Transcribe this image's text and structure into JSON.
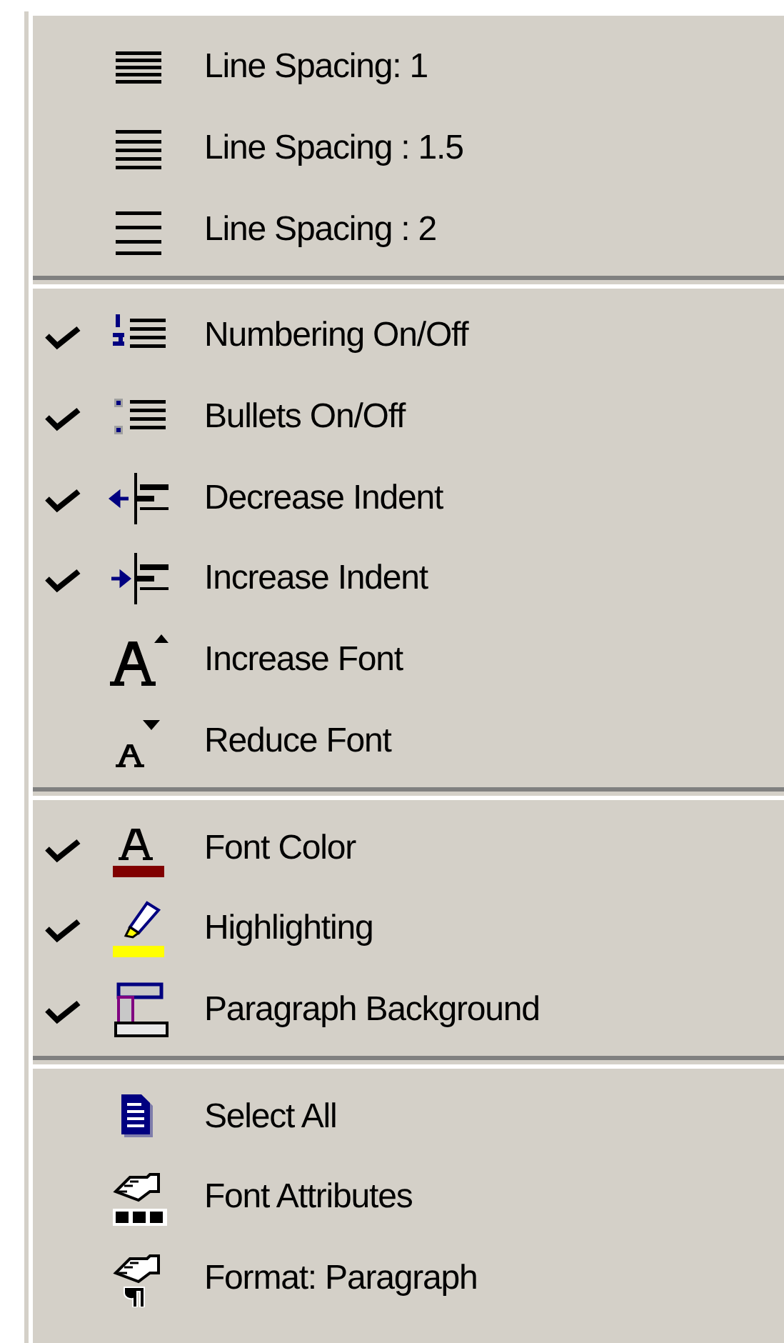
{
  "menu": {
    "groups": [
      {
        "items": [
          {
            "label": "Line Spacing: 1",
            "checked": false
          },
          {
            "label": "Line Spacing : 1.5",
            "checked": false
          },
          {
            "label": "Line Spacing : 2",
            "checked": false
          }
        ]
      },
      {
        "items": [
          {
            "label": "Numbering On/Off",
            "checked": true
          },
          {
            "label": "Bullets On/Off",
            "checked": true
          },
          {
            "label": "Decrease Indent",
            "checked": true
          },
          {
            "label": "Increase Indent",
            "checked": true
          },
          {
            "label": "Increase Font",
            "checked": false
          },
          {
            "label": "Reduce Font",
            "checked": false
          }
        ]
      },
      {
        "items": [
          {
            "label": "Font Color",
            "checked": true
          },
          {
            "label": "Highlighting",
            "checked": true
          },
          {
            "label": "Paragraph Background",
            "checked": true
          }
        ]
      },
      {
        "items": [
          {
            "label": "Select All",
            "checked": false
          },
          {
            "label": "Font Attributes",
            "checked": false
          },
          {
            "label": "Format: Paragraph",
            "checked": false
          }
        ]
      }
    ]
  }
}
